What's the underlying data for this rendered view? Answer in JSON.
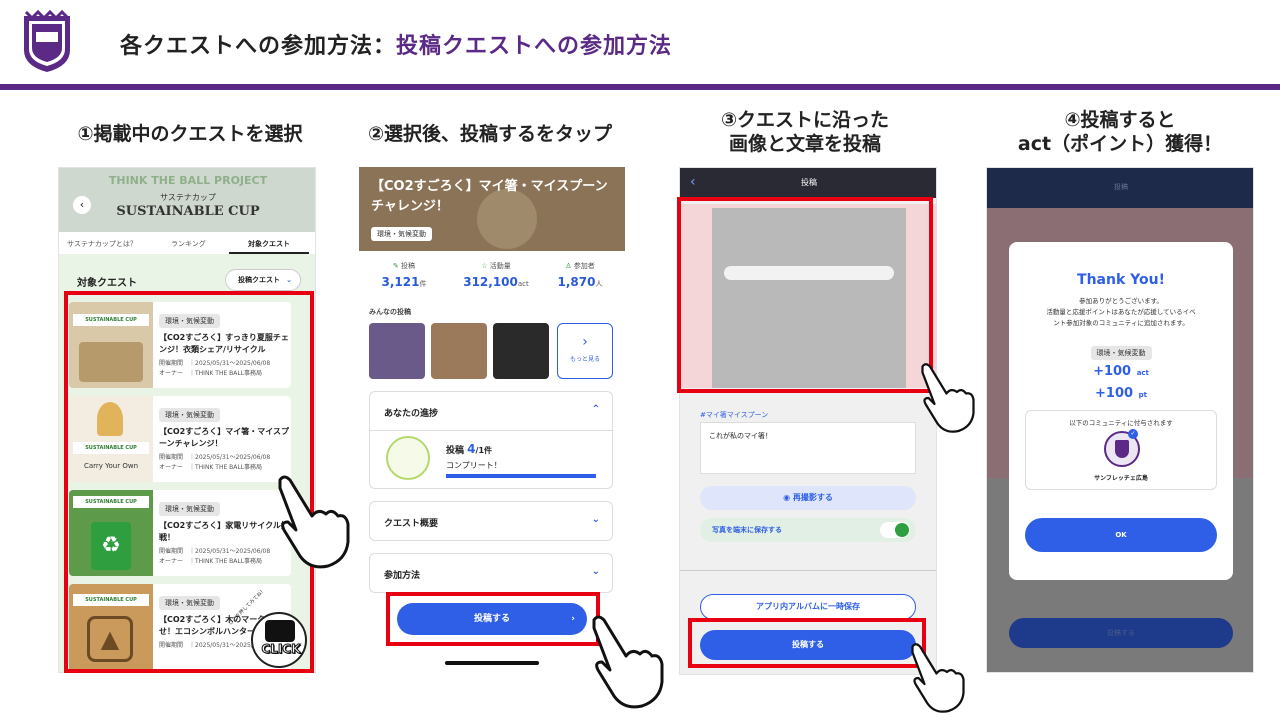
{
  "header": {
    "title_prefix": "各クエストへの参加方法：",
    "title_highlight": "投稿クエストへの参加方法"
  },
  "colors": {
    "brand": "#5b2a86",
    "accent_blue": "#2e5fe6",
    "highlight_red": "#e60012"
  },
  "steps": {
    "s1": "①掲載中のクエストを選択",
    "s2": "②選択後、投稿するをタップ",
    "s3_line1": "③クエストに沿った",
    "s3_line2": "画像と文章を投稿",
    "s4_line1": "④投稿すると",
    "s4_line2": "act（ポイント）獲得！"
  },
  "screen1": {
    "banner_line1": "THINK THE BALL PROJECT",
    "banner_line2": "サステナカップ",
    "banner_line3": "SUSTAINABLE CUP",
    "tabs": [
      "サステナカップとは？",
      "ランキング",
      "対象クエスト"
    ],
    "section_title": "対象クエスト",
    "filter_label": "投稿クエスト",
    "quests": [
      {
        "tag": "環境・気候変動",
        "title": "【CO2すごろく】すっきり夏服チェンジ！衣類シェア/リサイクル",
        "period": "開催期間　｜2025/05/31〜2025/06/08",
        "owner": "オーナー　｜THINK THE BALL事務局"
      },
      {
        "tag": "環境・気候変動",
        "title": "【CO2すごろく】マイ箸・マイスプーンチャレンジ！",
        "period": "開催期間　｜2025/05/31〜2025/06/08",
        "owner": "オーナー　｜THINK THE BALL事務局",
        "img_caption": "Carry Your Own"
      },
      {
        "tag": "環境・気候変動",
        "title": "【CO2すごろく】家電リサイクル挑戦！",
        "period": "開催期間　｜2025/05/31〜2025/06/08",
        "owner": "オーナー　｜THINK THE BALL事務局"
      },
      {
        "tag": "環境・気候変動",
        "title": "【CO2すごろく】木のマークを探せ！エコシンボルハンター",
        "period": "開催期間　｜2025/05/31〜2025/06/08",
        "owner": "オーナー　｜THINK THE BALL事務局"
      }
    ],
    "card_logo": "SUSTAINABLE CUP",
    "click_label": "CLICK",
    "click_arc": "ここを押してみてね！"
  },
  "screen2": {
    "banner_title": "【CO2すごろく】マイ箸・マイスプーンチャレンジ！",
    "banner_tag": "環境・気候変動",
    "stats": [
      {
        "label": "投稿",
        "value": "3,121",
        "unit": "件"
      },
      {
        "label": "活動量",
        "value": "312,100",
        "unit": "act"
      },
      {
        "label": "参加者",
        "value": "1,870",
        "unit": "人"
      }
    ],
    "posts_label": "みんなの投稿",
    "more_label": "もっと見る",
    "progress_title": "あなたの進捗",
    "progress_count_label": "投稿",
    "progress_count": "4",
    "progress_total": "/1件",
    "progress_status": "コンプリート！",
    "progress_fraction": 1.0,
    "overview_label": "クエスト概要",
    "howto_label": "参加方法",
    "post_button": "投稿する"
  },
  "screen3": {
    "nav_title": "投稿",
    "hashtag": "#マイ箸マイスプーン",
    "caption_text": "これが私のマイ箸！",
    "retake_label": "再撮影する",
    "save_toggle_label": "写真を端末に保存する",
    "save_toggle_on": true,
    "album_button": "アプリ内アルバムに一時保存",
    "post_button": "投稿する"
  },
  "screen4": {
    "nav_title": "投稿",
    "thank_you": "Thank You!",
    "msg_line1": "参加ありがとうございます。",
    "msg_line2": "活動量と応援ポイントはあなたが応援しているイベ",
    "msg_line3": "ント参加対象のコミュニティに追加されます。",
    "tag": "環境・気候変動",
    "act_value": "+100",
    "act_unit": "act",
    "pt_value": "+100",
    "pt_unit": "pt",
    "community_intro": "以下のコミュニティに付与されます",
    "community_name": "サンフレッチェ広島",
    "ok_label": "OK",
    "bottom_button": "投稿する"
  }
}
